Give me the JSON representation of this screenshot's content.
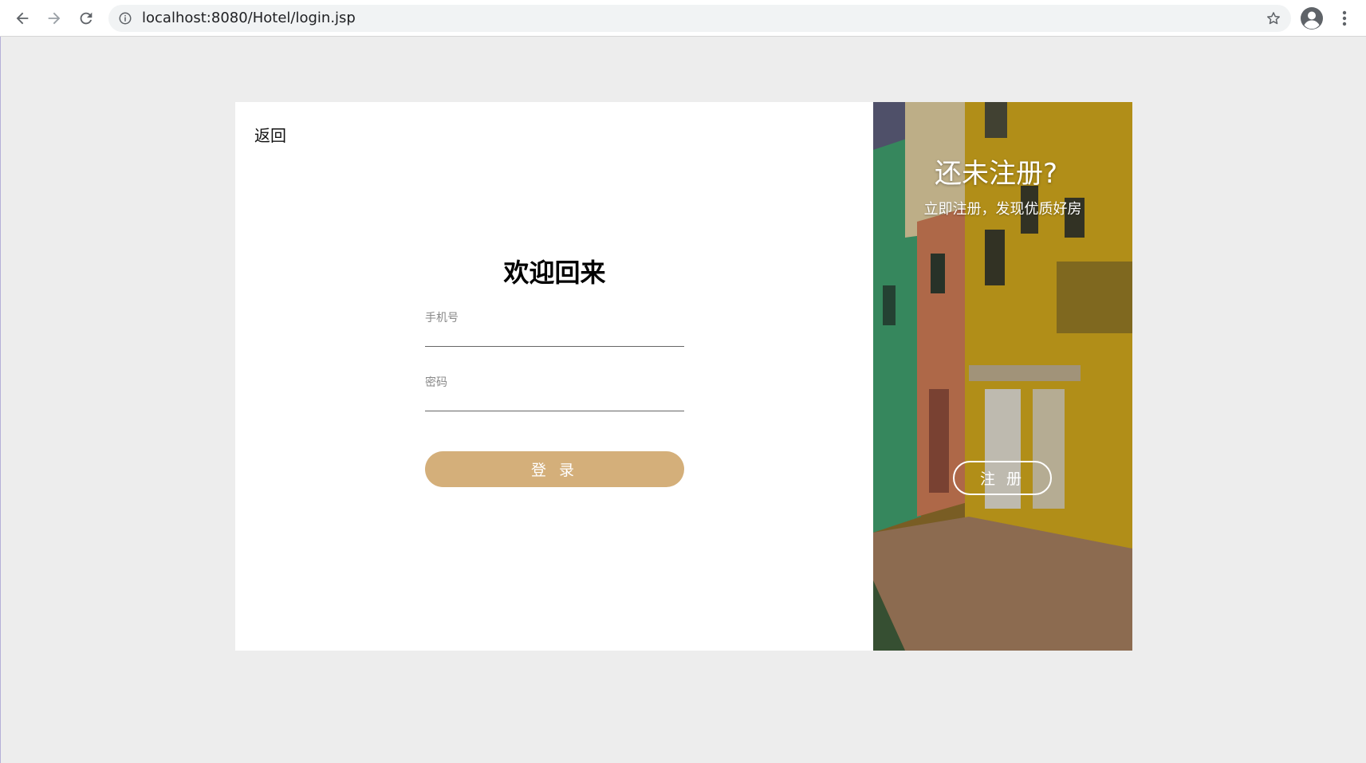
{
  "browser": {
    "url": "localhost:8080/Hotel/login.jsp"
  },
  "page": {
    "back_label": "返回",
    "form": {
      "title": "欢迎回来",
      "phone_label": "手机号",
      "phone_value": "",
      "password_label": "密码",
      "password_value": "",
      "login_label": "登 录"
    },
    "side": {
      "title": "还未注册?",
      "subtitle": "立即注册，发现优质好房",
      "register_label": "注 册"
    }
  },
  "colors": {
    "page_background": "#ededed",
    "login_button": "#d4af7a",
    "register_button_border": "#ffffff"
  },
  "icons": {
    "back": "arrow-left-icon",
    "forward": "arrow-right-icon",
    "reload": "reload-icon",
    "info": "info-icon",
    "bookmark": "star-icon",
    "profile": "account-icon",
    "menu": "more-vert-icon"
  }
}
